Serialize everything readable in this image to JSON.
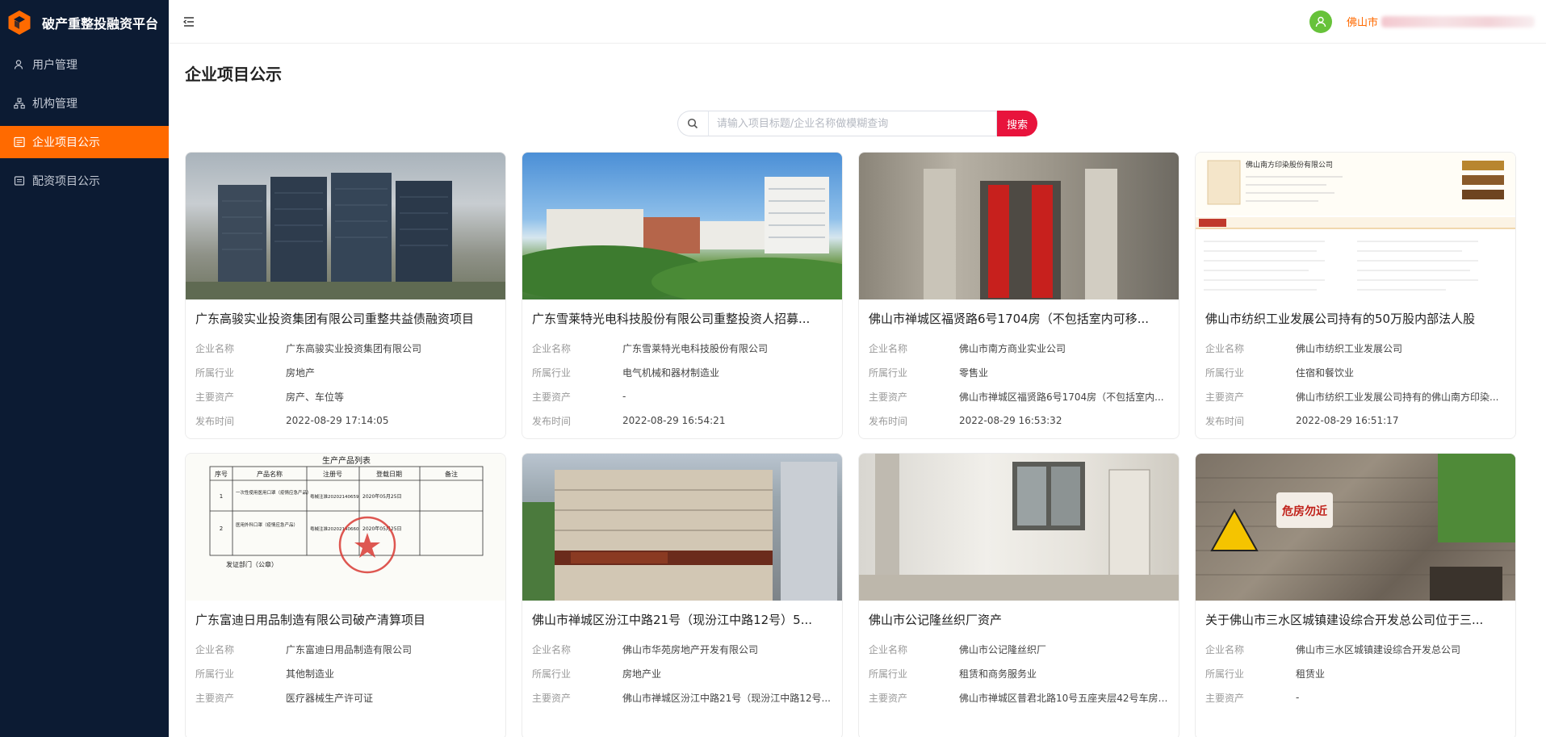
{
  "brand": {
    "title": "破产重整投融资平台",
    "logo_icon": "hexagon-logo-icon",
    "logo_color": "#ff6a00"
  },
  "sidebar": {
    "items": [
      {
        "label": "用户管理",
        "icon": "user-icon",
        "active": false
      },
      {
        "label": "机构管理",
        "icon": "org-chart-icon",
        "active": false
      },
      {
        "label": "企业项目公示",
        "icon": "list-icon",
        "active": true
      },
      {
        "label": "配资项目公示",
        "icon": "document-icon",
        "active": false
      }
    ]
  },
  "header": {
    "user_name": "佛山市",
    "user_icon": "avatar-user-icon"
  },
  "page": {
    "title": "企业项目公示"
  },
  "search": {
    "placeholder": "请输入项目标题/企业名称做模糊查询",
    "button_label": "搜索"
  },
  "field_labels": {
    "company": "企业名称",
    "industry": "所属行业",
    "assets": "主要资产",
    "published": "发布时间"
  },
  "cards": [
    {
      "title": "广东高骏实业投资集团有限公司重整共益债融资项目",
      "company": "广东高骏实业投资集团有限公司",
      "industry": "房地产",
      "assets": "房产、车位等",
      "published": "2022-08-29 17:14:05"
    },
    {
      "title": "广东雪莱特光电科技股份有限公司重整投资人招募...",
      "company": "广东雪莱特光电科技股份有限公司",
      "industry": "电气机械和器材制造业",
      "assets": "-",
      "published": "2022-08-29 16:54:21"
    },
    {
      "title": "佛山市禅城区福贤路6号1704房（不包括室内可移...",
      "company": "佛山市南方商业实业公司",
      "industry": "零售业",
      "assets": "佛山市禅城区福贤路6号1704房（不包括室内...",
      "published": "2022-08-29 16:53:32"
    },
    {
      "title": "佛山市纺织工业发展公司持有的50万股内部法人股",
      "company": "佛山市纺织工业发展公司",
      "industry": "住宿和餐饮业",
      "assets": "佛山市纺织工业发展公司持有的佛山南方印染...",
      "published": "2022-08-29 16:51:17"
    },
    {
      "title": "广东富迪日用品制造有限公司破产清算项目",
      "company": "广东富迪日用品制造有限公司",
      "industry": "其他制造业",
      "assets": "医疗器械生产许可证",
      "published": ""
    },
    {
      "title": "佛山市禅城区汾江中路21号（现汾江中路12号）5...",
      "company": "佛山市华苑房地产开发有限公司",
      "industry": "房地产业",
      "assets": "佛山市禅城区汾江中路21号（现汾江中路12号...",
      "published": ""
    },
    {
      "title": "佛山市公记隆丝织厂资产",
      "company": "佛山市公记隆丝织厂",
      "industry": "租赁和商务服务业",
      "assets": "佛山市禅城区普君北路10号五座夹层42号车房 ...",
      "published": ""
    },
    {
      "title": "关于佛山市三水区城镇建设综合开发总公司位于三...",
      "company": "佛山市三水区城镇建设综合开发总公司",
      "industry": "租赁业",
      "assets": "-",
      "published": ""
    }
  ],
  "image_texts": {
    "doc_title": "生产产品列表",
    "doc_headers": [
      "序号",
      "产品名称",
      "注册号",
      "登载日期",
      "备注"
    ],
    "doc_rows": [
      [
        "1",
        "一次性使用医用口罩（疫情应急产品）",
        "粤械注准20202140659",
        "2020年05月25日",
        ""
      ],
      [
        "2",
        "医用外科口罩（疫情应急产品）",
        "粤械注准20202140660",
        "2020年05月25日",
        ""
      ]
    ],
    "doc_issuer": "发证部门（公章）",
    "danger_sign": "危房勿近",
    "shot_company": "佛山南方印染股份有限公司"
  },
  "colors": {
    "sidebar_bg": "#0c1b33",
    "accent": "#ff6a00",
    "search_btn": "#e8133c",
    "avatar_bg": "#67c23a"
  }
}
